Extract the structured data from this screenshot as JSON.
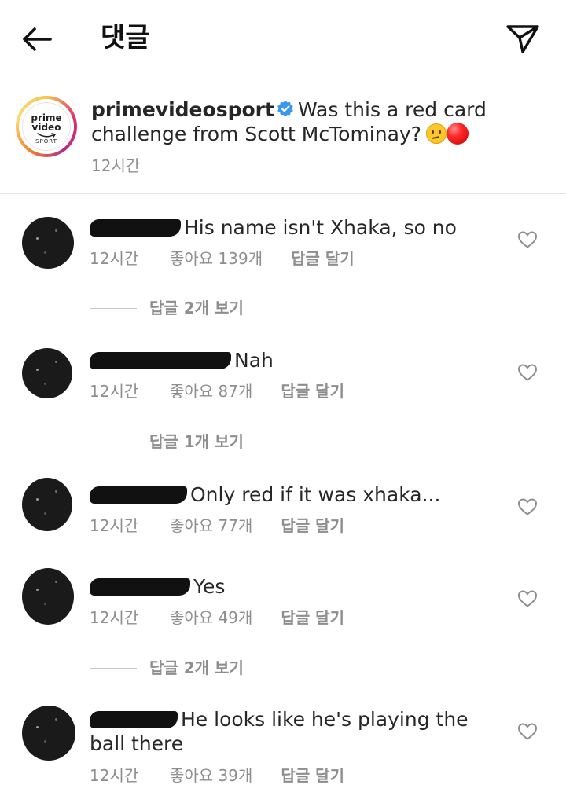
{
  "header": {
    "title": "댓글",
    "back_icon": "arrow-left-icon",
    "share_icon": "paper-plane-icon"
  },
  "caption": {
    "avatar_logo": {
      "line1": "prime",
      "line2": "video",
      "line3": "SPORT"
    },
    "username": "primevideosport",
    "verified_icon": "verified-badge-icon",
    "text": "Was this a red card challenge from Scott McTominay?",
    "emojis": [
      "thinking-face-emoji",
      "red-circle-emoji"
    ],
    "time": "12시간"
  },
  "comments": [
    {
      "text": "His name isn't Xhaka, so no",
      "time": "12시간",
      "likes": "좋아요 139개",
      "reply": "답글 달기",
      "view_replies": "답글 2개 보기"
    },
    {
      "text": "Nah",
      "time": "12시간",
      "likes": "좋아요 87개",
      "reply": "답글 달기",
      "view_replies": "답글 1개 보기"
    },
    {
      "text": "Only red if it was xhaka...",
      "time": "12시간",
      "likes": "좋아요 77개",
      "reply": "답글 달기"
    },
    {
      "text": "Yes",
      "time": "12시간",
      "likes": "좋아요 49개",
      "reply": "답글 달기",
      "view_replies": "답글 2개 보기"
    },
    {
      "text": "He looks like he's playing the ball there",
      "time": "12시간",
      "likes": "좋아요 39개",
      "reply": "답글 달기"
    }
  ],
  "colors": {
    "text": "#262626",
    "secondary": "#8e8e8e",
    "verified": "#3897f0"
  }
}
